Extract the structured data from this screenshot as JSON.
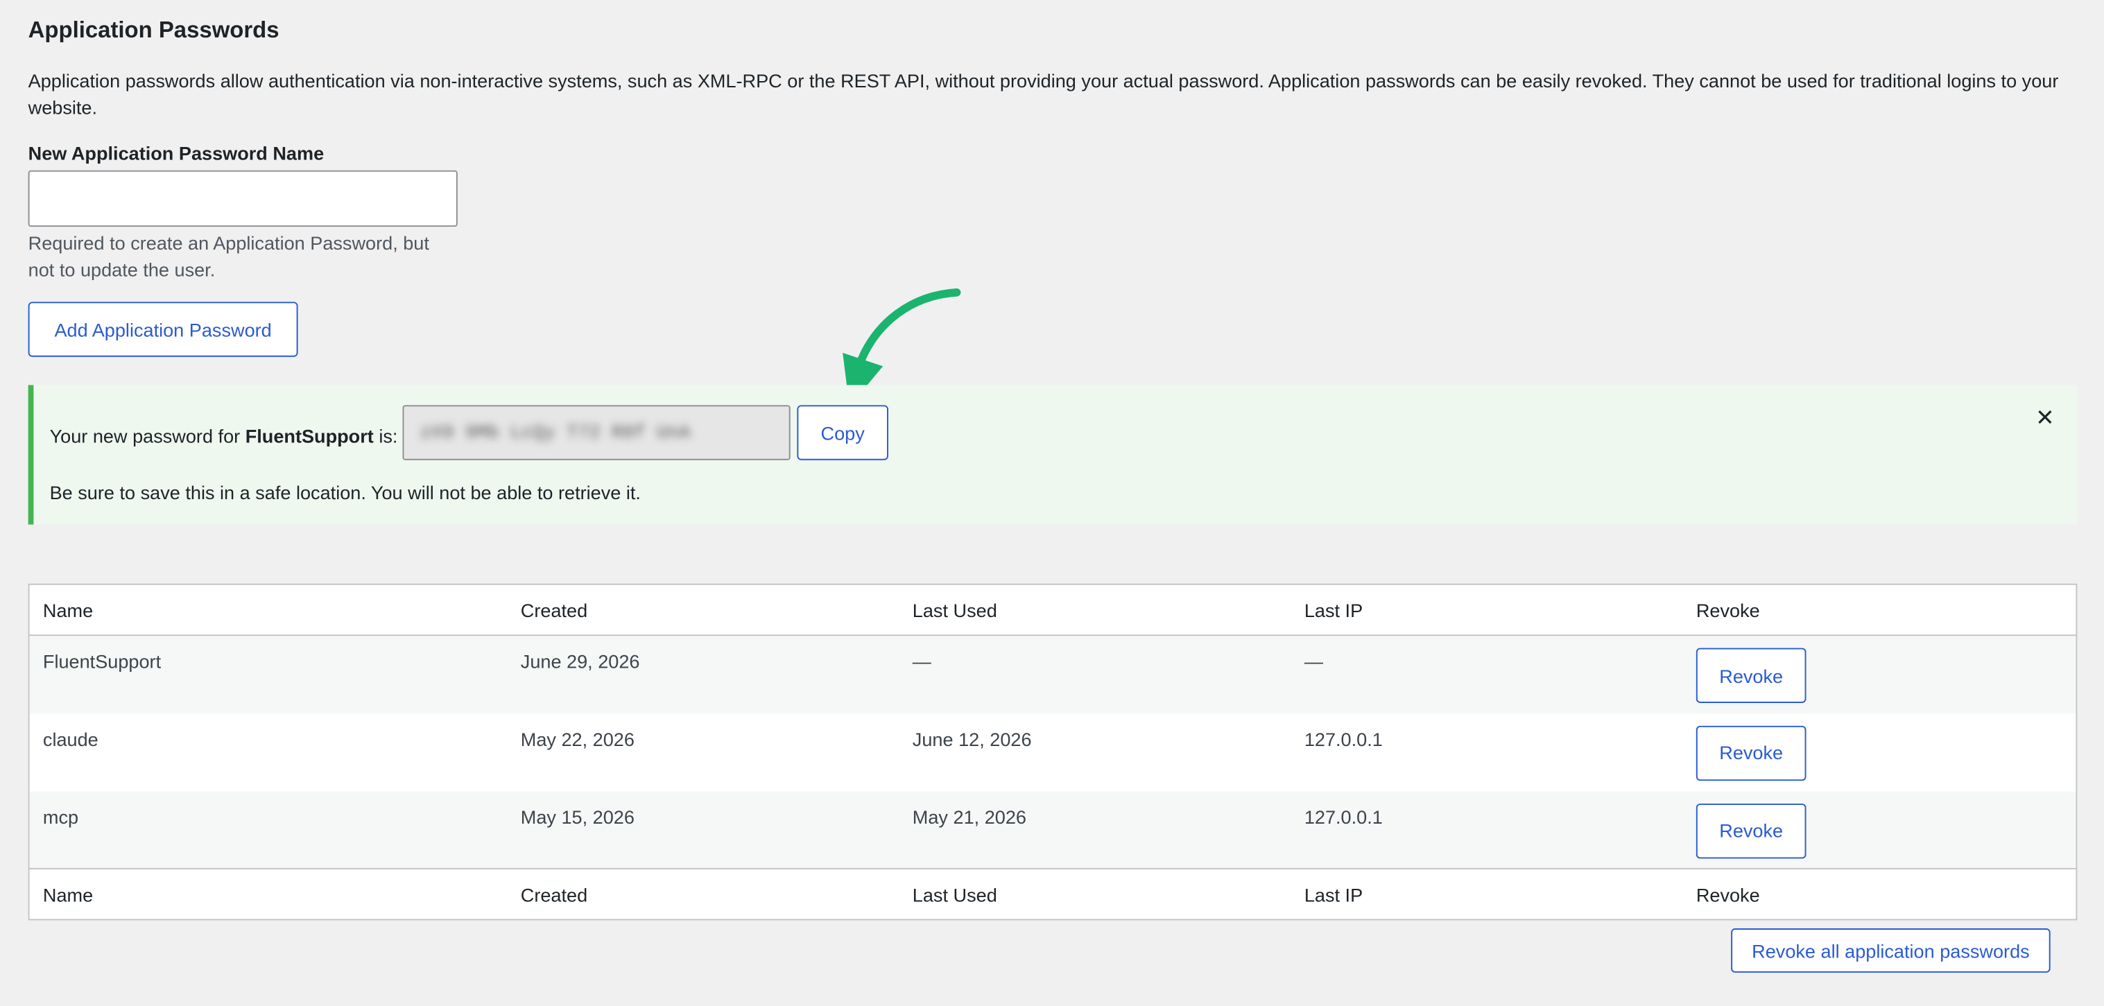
{
  "page": {
    "title": "Application Passwords",
    "description": "Application passwords allow authentication via non-interactive systems, such as XML-RPC or the REST API, without providing your actual password. Application passwords can be easily revoked. They cannot be used for traditional logins to your website."
  },
  "form": {
    "name_label": "New Application Password Name",
    "name_value": "",
    "help_text": "Required to create an Application Password, but not to update the user.",
    "add_button": "Add Application Password"
  },
  "notice": {
    "prefix": "Your new password for ",
    "app_name": "FluentSupport",
    "suffix": " is:",
    "password": "zX9 9Mb LcQy T72 R8f UnA",
    "copy_button": "Copy",
    "warning": "Be sure to save this in a safe location. You will not be able to retrieve it.",
    "dismiss_glyph": "✕",
    "arrow_color": "#1bb46e"
  },
  "table": {
    "columns": [
      "Name",
      "Created",
      "Last Used",
      "Last IP",
      "Revoke"
    ],
    "rows": [
      {
        "name": "FluentSupport",
        "created": "June 29, 2026",
        "last_used": "—",
        "last_ip": "—",
        "revoke": "Revoke"
      },
      {
        "name": "claude",
        "created": "May 22, 2026",
        "last_used": "June 12, 2026",
        "last_ip": "127.0.0.1",
        "revoke": "Revoke"
      },
      {
        "name": "mcp",
        "created": "May 15, 2026",
        "last_used": "May 21, 2026",
        "last_ip": "127.0.0.1",
        "revoke": "Revoke"
      }
    ]
  },
  "revoke_all_button": "Revoke all application passwords",
  "colors": {
    "accent": "#2a5bd3",
    "success_border": "#46b450",
    "notice_bg": "#eef8ef",
    "page_bg": "#f0f0f1"
  }
}
